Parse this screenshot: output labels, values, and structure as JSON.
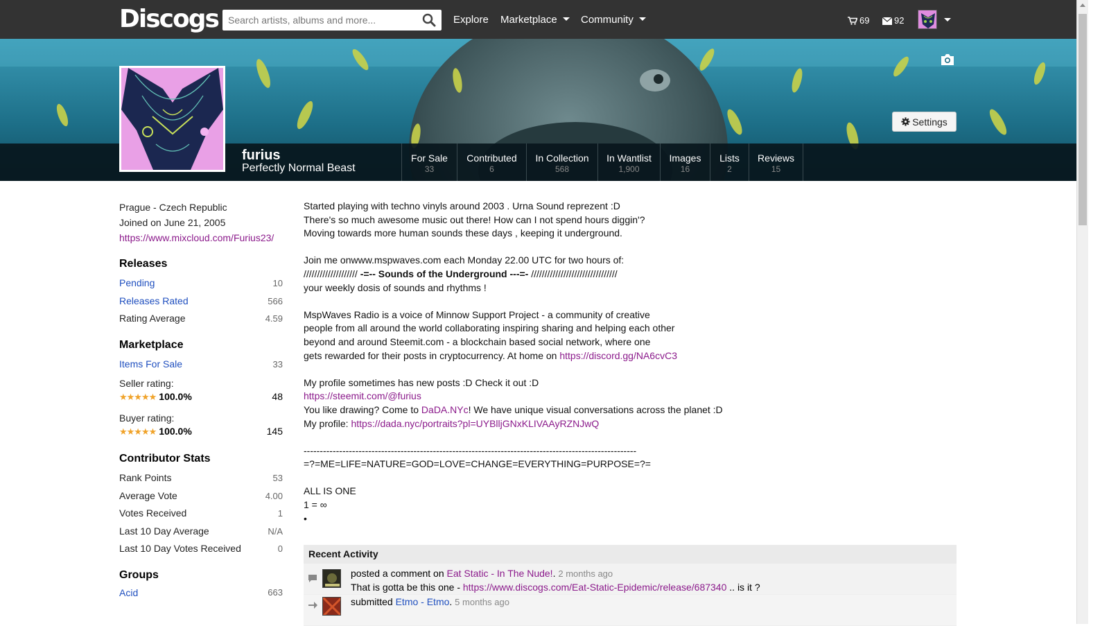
{
  "nav": {
    "logo": "Discogs",
    "search_placeholder": "Search artists, albums and more...",
    "links": {
      "explore": "Explore",
      "marketplace": "Marketplace",
      "community": "Community"
    },
    "cart_count": "69",
    "messages_count": "92"
  },
  "banner": {
    "settings_label": "Settings"
  },
  "profile": {
    "username": "furius",
    "tagline": "Perfectly Normal Beast",
    "tabs": [
      {
        "label": "For Sale",
        "count": "33"
      },
      {
        "label": "Contributed",
        "count": "6"
      },
      {
        "label": "In Collection",
        "count": "568"
      },
      {
        "label": "In Wantlist",
        "count": "1,900"
      },
      {
        "label": "Images",
        "count": "16"
      },
      {
        "label": "Lists",
        "count": "2"
      },
      {
        "label": "Reviews",
        "count": "15"
      }
    ]
  },
  "sidebar": {
    "location": "Prague - Czech Republic",
    "joined": "Joined on June 21, 2005",
    "website": "https://www.mixcloud.com/Furius23/",
    "releases": {
      "heading": "Releases",
      "pending_label": "Pending",
      "pending_value": "10",
      "rated_label": "Releases Rated",
      "rated_value": "566",
      "avg_label": "Rating Average",
      "avg_value": "4.59"
    },
    "marketplace": {
      "heading": "Marketplace",
      "items_label": "Items For Sale",
      "items_value": "33",
      "seller_label": "Seller rating:",
      "seller_pct": "100.0%",
      "seller_count": "48",
      "buyer_label": "Buyer rating:",
      "buyer_pct": "100.0%",
      "buyer_count": "145",
      "stars": "★★★★★"
    },
    "contributor": {
      "heading": "Contributor Stats",
      "rank_label": "Rank Points",
      "rank_value": "53",
      "avgvote_label": "Average Vote",
      "avgvote_value": "4.00",
      "votes_label": "Votes Received",
      "votes_value": "1",
      "last10avg_label": "Last 10 Day Average",
      "last10avg_value": "N/A",
      "last10votes_label": "Last 10 Day Votes Received",
      "last10votes_value": "0"
    },
    "groups": {
      "heading": "Groups",
      "acid_label": "Acid",
      "acid_value": "663"
    }
  },
  "bio": {
    "l1": "Started playing with techno vinyls around 2003 . Urna Sound reprezent :D",
    "l2": "There's so much awesome music out there! How can I not spend hours diggin'?",
    "l3": "Moving towards more human sounds these days , keeping it underground.",
    "l4": "Join me onwww.mspwaves.com each Monday 22.00 UTC for two hours of:",
    "l5a": "//////////////////// ",
    "l5b": "-=-- Sounds of the Underground ---=-",
    "l5c": " ////////////////////////////////",
    "l6": "your weekly dosis of sounds and rhythms !",
    "l7": "MspWaves Radio is a voice of Minnow Support Project - a community of creative",
    "l8": "people from all around the world collaborating inspiring sharing and helping each other",
    "l9": "beyond and around Steemit.com - a blockchain based social network, where one",
    "l10a": "gets rewarded for their posts in cryptocurrency. At home on ",
    "l10link": "https://discord.gg/NA6cvC3",
    "l11": "My profile sometimes has new posts :D Check it out :D",
    "l12link": "https://steemit.com/@furius",
    "l13a": "You like drawing? Come to ",
    "l13link": "DaDA.NYc",
    "l13b": "! We have unique visual conversations across the planet :D",
    "l14a": "My profile: ",
    "l14link": "https://dada.nyc/portraits?pl=UYBlljGNxKLIVAAyRZNJwQ",
    "l15": "-------------------------------------------------------------------------------------------------------",
    "l16": "=?=ME=LIFE=NATURE=GOD=LOVE=CHANGE=EVERYTHING=PURPOSE=?=",
    "l17": "ALL IS ONE",
    "l18": "1 = ∞",
    "l19": "•"
  },
  "activity": {
    "heading": "Recent Activity",
    "item1": {
      "verb": "posted a comment on ",
      "link": "Eat Static - In The Nude!",
      "time": "2 months ago",
      "text_a": "That is gotta be this one - ",
      "text_link": "https://www.discogs.com/Eat-Static-Epidemic/release/687340",
      "text_b": " .. is it ?"
    },
    "item2": {
      "verb": "submitted ",
      "link": "Etmo - Etmo",
      "time": "5 months ago"
    }
  }
}
